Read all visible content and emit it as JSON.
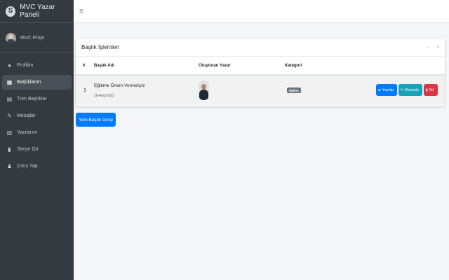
{
  "brand": {
    "title": "MVC Yazar Paneli",
    "logo_icon": "skype-like-logo-icon"
  },
  "user": {
    "name": "MVC Proje"
  },
  "sidebar": {
    "items": [
      {
        "label": "Profilim",
        "icon": "palette-icon",
        "glyph": "●"
      },
      {
        "label": "Başlıklarım",
        "icon": "grid-icon",
        "glyph": "▦",
        "active": true
      },
      {
        "label": "Tüm Başlıklar",
        "icon": "list-icon",
        "glyph": "▤"
      },
      {
        "label": "Mesajlar",
        "icon": "edit-icon",
        "glyph": "✎"
      },
      {
        "label": "Yazılarım",
        "icon": "calendar-icon",
        "glyph": "▥"
      },
      {
        "label": "Siteye Git",
        "icon": "book-icon",
        "glyph": "▮"
      },
      {
        "label": "Çıkış Yap",
        "icon": "user-icon",
        "glyph": "♟"
      }
    ]
  },
  "topbar": {
    "menu_icon": "hamburger-icon"
  },
  "card": {
    "title": "Başlık İşlemleri",
    "tools": {
      "collapse": "–",
      "close": "x"
    },
    "columns": [
      "#",
      "Başlık Adı",
      "Oluşturan Yazar",
      "Kategori"
    ],
    "rows": [
      {
        "num": "1",
        "title": "Eğitime Önem Vermeliyiz",
        "date": "10-Aug-2022",
        "category": "Eğitim",
        "actions": {
          "posts": "Yazılar",
          "edit": "Düzenle",
          "delete": "Sil"
        }
      }
    ]
  },
  "new_button": "Yeni Başlık Girişi",
  "colors": {
    "sidebar": "#343a40",
    "primary": "#007bff",
    "info": "#17a2b8",
    "danger": "#dc3545"
  }
}
